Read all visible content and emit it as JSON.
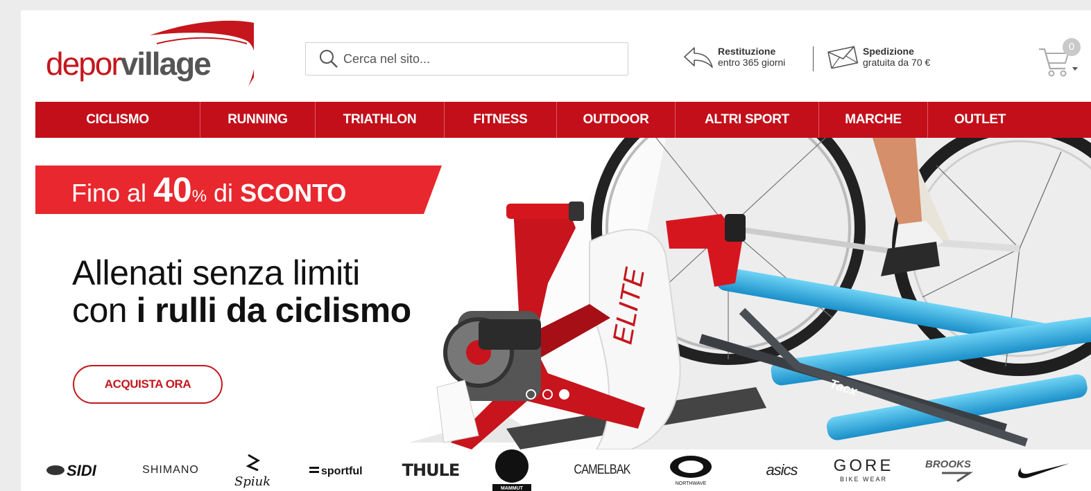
{
  "header": {
    "logo": {
      "part1": "depor",
      "part2": "village"
    },
    "search": {
      "placeholder": "Cerca nel sito..."
    },
    "returns": {
      "line1": "Restituzione",
      "line2": "entro 365 giorni"
    },
    "shipping": {
      "line1": "Spedizione",
      "line2": "gratuita da 70 €"
    },
    "cart": {
      "count": "0"
    }
  },
  "nav": {
    "items": [
      {
        "label": "CICLISMO"
      },
      {
        "label": "RUNNING"
      },
      {
        "label": "TRIATHLON"
      },
      {
        "label": "FITNESS"
      },
      {
        "label": "OUTDOOR"
      },
      {
        "label": "ALTRI SPORT"
      },
      {
        "label": "MARCHE"
      },
      {
        "label": "OUTLET"
      }
    ]
  },
  "hero": {
    "banner": {
      "prefix": "Fino al ",
      "number": "40",
      "percent": "%",
      "middle": " di ",
      "strong": "SCONTO"
    },
    "headline": {
      "line1": "Allenati senza limiti",
      "line2_plain": "con ",
      "line2_bold": "i rulli da ciclismo"
    },
    "cta": "ACQUISTA ORA",
    "slider": {
      "slides": 3,
      "active_index": 2
    },
    "product_labels": {
      "elite": "ELITE",
      "tacx": "Tacx"
    }
  },
  "brands": {
    "items": [
      {
        "name": "SIDI"
      },
      {
        "name": "SHIMANO"
      },
      {
        "name": "Spiuk"
      },
      {
        "name": "sportful"
      },
      {
        "name": "THULE"
      },
      {
        "name": "MAMMUT"
      },
      {
        "name": "CAMELBAK"
      },
      {
        "name": "NORTHWAVE"
      },
      {
        "name": "asics"
      },
      {
        "name": "GORE",
        "sub": "BIKE WEAR"
      },
      {
        "name": "BROOKS"
      },
      {
        "name": "Nike"
      }
    ]
  },
  "colors": {
    "brand_red": "#c30f1a",
    "accent_red": "#e8282e",
    "slate": "#555555"
  }
}
